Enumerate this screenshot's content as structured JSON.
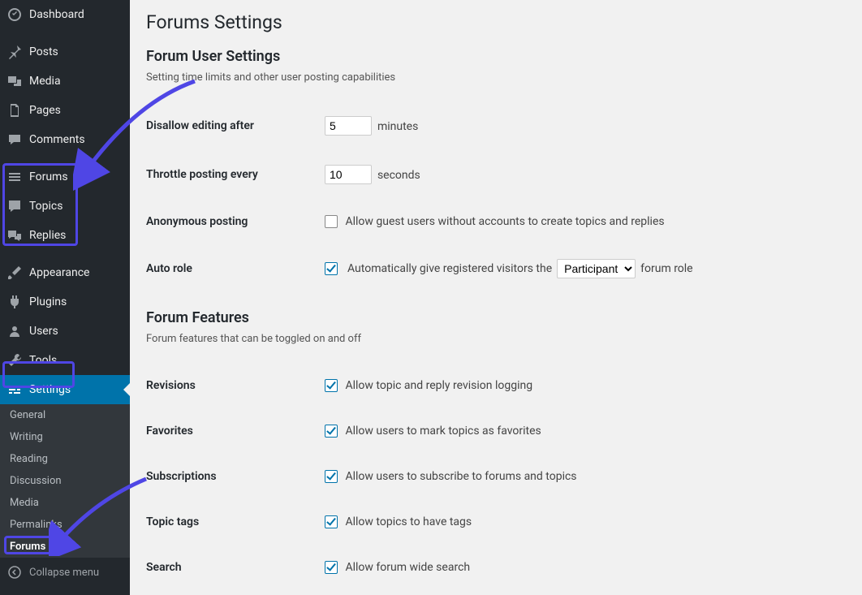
{
  "page": {
    "title": "Forums Settings"
  },
  "sidebar": {
    "items": [
      {
        "label": "Dashboard",
        "icon": "dashboard"
      },
      {
        "label": "Posts",
        "icon": "pin"
      },
      {
        "label": "Media",
        "icon": "media"
      },
      {
        "label": "Pages",
        "icon": "page"
      },
      {
        "label": "Comments",
        "icon": "comment"
      },
      {
        "label": "Forums",
        "icon": "forums"
      },
      {
        "label": "Topics",
        "icon": "topics"
      },
      {
        "label": "Replies",
        "icon": "replies"
      },
      {
        "label": "Appearance",
        "icon": "brush"
      },
      {
        "label": "Plugins",
        "icon": "plug"
      },
      {
        "label": "Users",
        "icon": "user"
      },
      {
        "label": "Tools",
        "icon": "wrench"
      },
      {
        "label": "Settings",
        "icon": "sliders"
      }
    ],
    "sub": [
      {
        "label": "General"
      },
      {
        "label": "Writing"
      },
      {
        "label": "Reading"
      },
      {
        "label": "Discussion"
      },
      {
        "label": "Media"
      },
      {
        "label": "Permalinks"
      },
      {
        "label": "Forums"
      }
    ],
    "collapse": "Collapse menu"
  },
  "sections": {
    "user": {
      "heading": "Forum User Settings",
      "desc": "Setting time limits and other user posting capabilities",
      "rows": {
        "editing": {
          "label": "Disallow editing after",
          "value": "5",
          "suffix": "minutes"
        },
        "throttle": {
          "label": "Throttle posting every",
          "value": "10",
          "suffix": "seconds"
        },
        "anon": {
          "label": "Anonymous posting",
          "desc": "Allow guest users without accounts to create topics and replies"
        },
        "autorole": {
          "label": "Auto role",
          "desc_pre": "Automatically give registered visitors the",
          "select": "Participant",
          "desc_post": "forum role"
        }
      }
    },
    "features": {
      "heading": "Forum Features",
      "desc": "Forum features that can be toggled on and off",
      "rows": {
        "revisions": {
          "label": "Revisions",
          "desc": "Allow topic and reply revision logging"
        },
        "favorites": {
          "label": "Favorites",
          "desc": "Allow users to mark topics as favorites"
        },
        "subscriptions": {
          "label": "Subscriptions",
          "desc": "Allow users to subscribe to forums and topics"
        },
        "tags": {
          "label": "Topic tags",
          "desc": "Allow topics to have tags"
        },
        "search": {
          "label": "Search",
          "desc": "Allow forum wide search"
        }
      }
    }
  }
}
